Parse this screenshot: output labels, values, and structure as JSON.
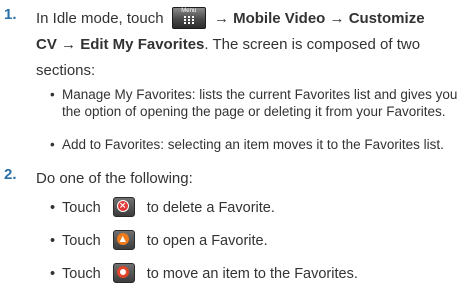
{
  "step1": {
    "number": "1.",
    "text_before_icon": "In Idle mode, touch",
    "menu_icon_label": "Menu",
    "path_part1": "Mobile Video",
    "path_part2": "Customize",
    "path_part3": "CV",
    "path_part4": "Edit My Favorites",
    "arrow": "→",
    "after_path": ". The screen is composed of two",
    "line3": "sections:",
    "bullets": [
      {
        "line1": "Manage My Favorites: lists the current Favorites list and gives you",
        "line2": "the option of opening the page or deleting it from your Favorites."
      },
      {
        "line1": "Add to Favorites: selecting an item moves it to the Favorites list."
      }
    ]
  },
  "step2": {
    "number": "2.",
    "text": "Do one of the following:",
    "actions": [
      {
        "prefix": "Touch",
        "icon": "delete-icon",
        "suffix": "to delete a Favorite."
      },
      {
        "prefix": "Touch",
        "icon": "open-icon",
        "suffix": "to open a Favorite."
      },
      {
        "prefix": "Touch",
        "icon": "move-icon",
        "suffix": "to move an item to the Favorites."
      }
    ]
  },
  "bullet_char": "•",
  "colors": {
    "step_number": "#2a6ea6",
    "text": "#333333",
    "delete_icon": "#e23a3a",
    "open_icon": "#f07b1c",
    "move_icon": "#e0462a"
  }
}
